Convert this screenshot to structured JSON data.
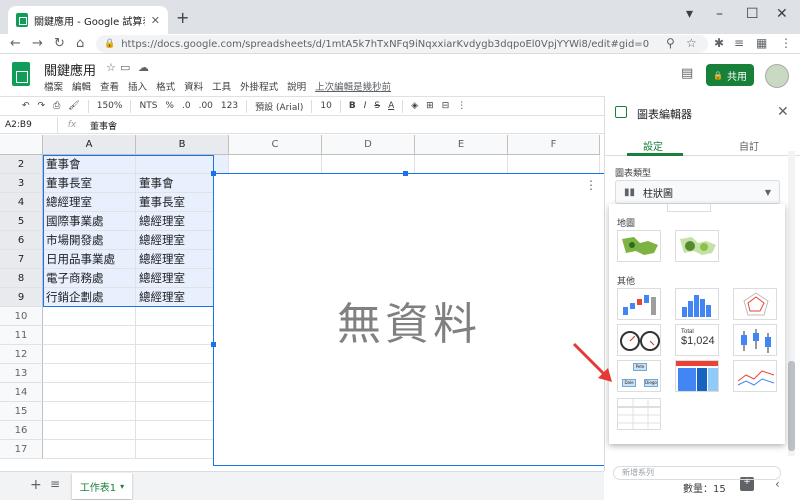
{
  "browser": {
    "tab_title": "關鍵應用 - Google 試算表",
    "url": "https://docs.google.com/spreadsheets/d/1mtA5k7hTxNFq9iNqxxiarKvdygb3dqpoEl0VpjYYWi8/edit#gid=0"
  },
  "doc": {
    "title": "關鍵應用",
    "menus": [
      "檔案",
      "編輯",
      "查看",
      "插入",
      "格式",
      "資料",
      "工具",
      "外掛程式",
      "說明"
    ],
    "last_edit": "上次編輯是幾秒前",
    "share_label": "共用"
  },
  "toolbar": {
    "zoom": "150%",
    "currency": "NTS",
    "percent": "%",
    "dec_decrease": ".0",
    "dec_increase": ".00",
    "format": "123",
    "font": "預設 (Arial)",
    "font_size": "10",
    "bold": "B",
    "italic": "I",
    "strike": "S",
    "text_color": "A"
  },
  "formula_bar": {
    "name_box": "A2:B9",
    "fx": "fx",
    "content": "董事會"
  },
  "grid": {
    "columns": [
      "A",
      "B",
      "C",
      "D",
      "E",
      "F"
    ],
    "rows": [
      "2",
      "3",
      "4",
      "5",
      "6",
      "7",
      "8",
      "9",
      "10",
      "11",
      "12",
      "13",
      "14",
      "15",
      "16",
      "17"
    ],
    "cells": [
      [
        "董事會",
        ""
      ],
      [
        "董事長室",
        "董事會"
      ],
      [
        "總經理室",
        "董事長室"
      ],
      [
        "國際事業處",
        "總經理室"
      ],
      [
        "市場開發處",
        "總經理室"
      ],
      [
        "日用品事業處",
        "總經理室"
      ],
      [
        "電子商務處",
        "總經理室"
      ],
      [
        "行銷企劃處",
        "總經理室"
      ]
    ]
  },
  "chart": {
    "no_data": "無資料"
  },
  "bottom": {
    "sheet_name": "工作表1",
    "count": "數量：15"
  },
  "chart_editor": {
    "title": "圖表編輯器",
    "tab_setup": "設定",
    "tab_customize": "自訂",
    "chart_type_label": "圖表類型",
    "chart_type_value": "柱狀圖",
    "section_map": "地圖",
    "section_other": "其他",
    "scorecard_title": "Total",
    "scorecard_value": "$1,024",
    "org_nodes": [
      "Pete",
      "Dale",
      "Diego"
    ],
    "search_placeholder": "新增系列"
  },
  "colors": {
    "accent": "#188038",
    "selection": "#1a73e8",
    "arrow": "#e53935"
  }
}
